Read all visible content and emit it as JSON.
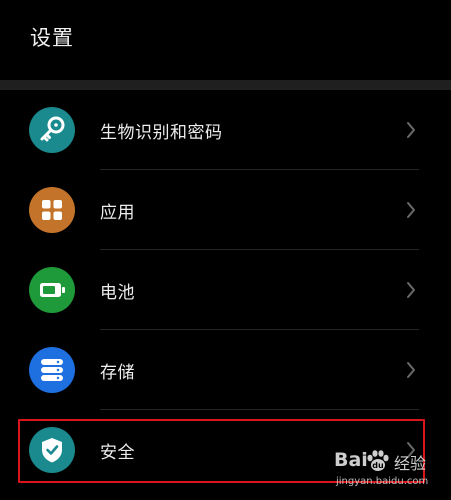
{
  "header": {
    "title": "设置"
  },
  "settings": {
    "items": [
      {
        "label": "生物识别和密码",
        "icon": "key-icon",
        "color": "#1a8a8e"
      },
      {
        "label": "应用",
        "icon": "apps-grid-icon",
        "color": "#c4742a"
      },
      {
        "label": "电池",
        "icon": "battery-icon",
        "color": "#1f9a3a"
      },
      {
        "label": "存储",
        "icon": "storage-icon",
        "color": "#1e6fe0"
      },
      {
        "label": "安全",
        "icon": "shield-check-icon",
        "color": "#1a8a8e"
      }
    ]
  },
  "watermark": {
    "brand": "Bai",
    "brand_suffix": "经验",
    "url": "jingyan.baidu.com"
  },
  "colors": {
    "background": "#000000",
    "highlight": "#d8161c"
  }
}
